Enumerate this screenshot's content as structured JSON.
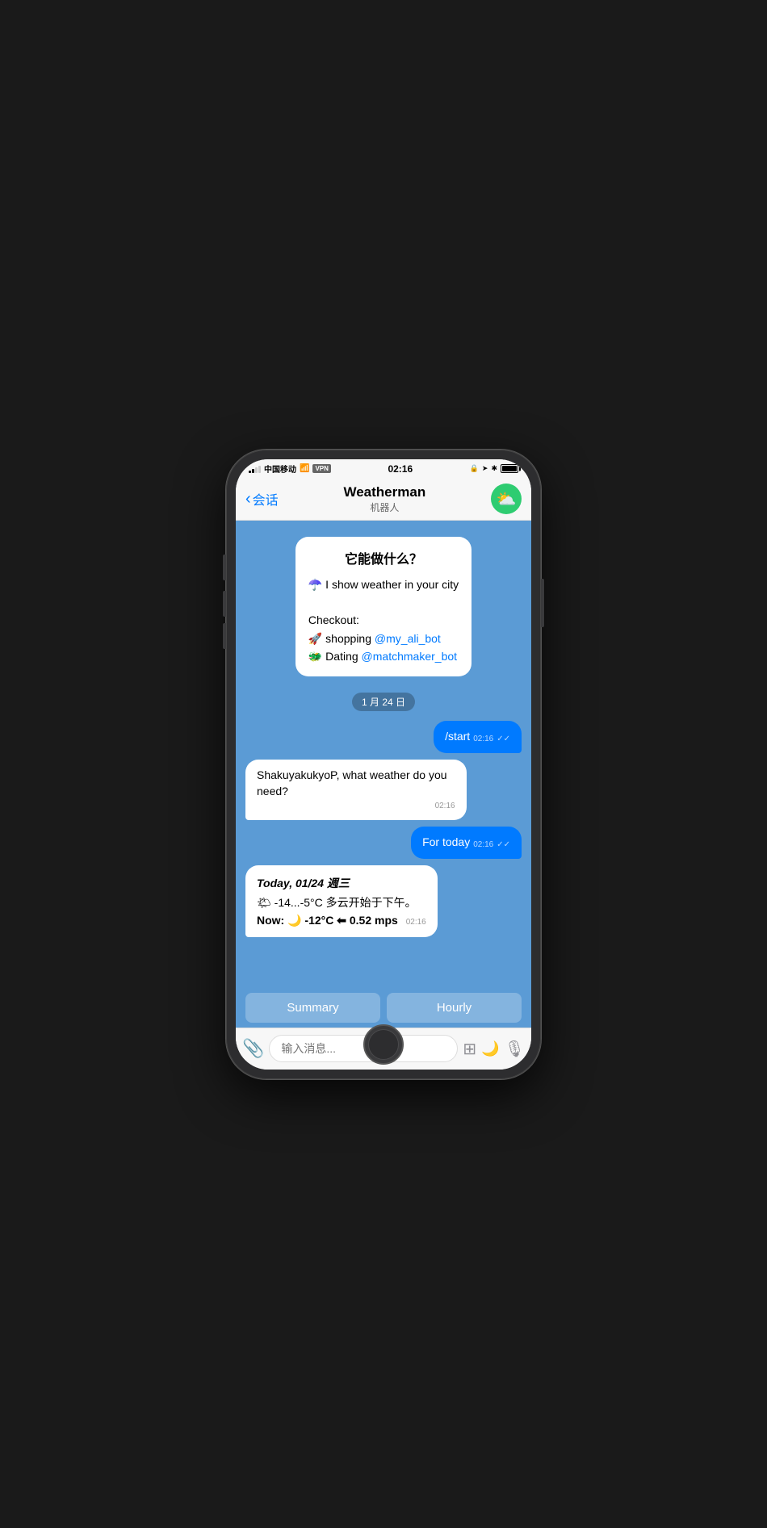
{
  "statusBar": {
    "carrier": "中国移动",
    "wifi": "WiFi",
    "vpn": "VPN",
    "time": "02:16",
    "battery": "100"
  },
  "navBar": {
    "backLabel": "会话",
    "title": "Weatherman",
    "subtitle": "机器人"
  },
  "chat": {
    "introTitle": "它能做什么？",
    "introLine1": "☂️ I show weather in your city",
    "introCheckout": "Checkout:",
    "introShopping": "🚀 shopping ",
    "introShoppingLink": "@my_ali_bot",
    "introDating": "🐲 Dating ",
    "introDatingLink": "@matchmaker_bot",
    "dateDivider": "1 月 24 日",
    "userMsg1": "/start",
    "userMsg1Time": "02:16",
    "botMsg1": "ShakuyakukyoP, what weather do you need?",
    "botMsg1Time": "02:16",
    "userMsg2": "For today",
    "userMsg2Time": "02:16",
    "weatherTitle": "Today, 01/24 週三",
    "weatherLine1": "🌤 -14...-5°C 多云开始于下午。",
    "weatherNow": "Now: 🌙 -12°C ⬅ 0.52 mps",
    "weatherTime": "02:16",
    "summaryBtn": "Summary",
    "hourlyBtn": "Hourly"
  },
  "inputBar": {
    "placeholder": "输入消息..."
  }
}
